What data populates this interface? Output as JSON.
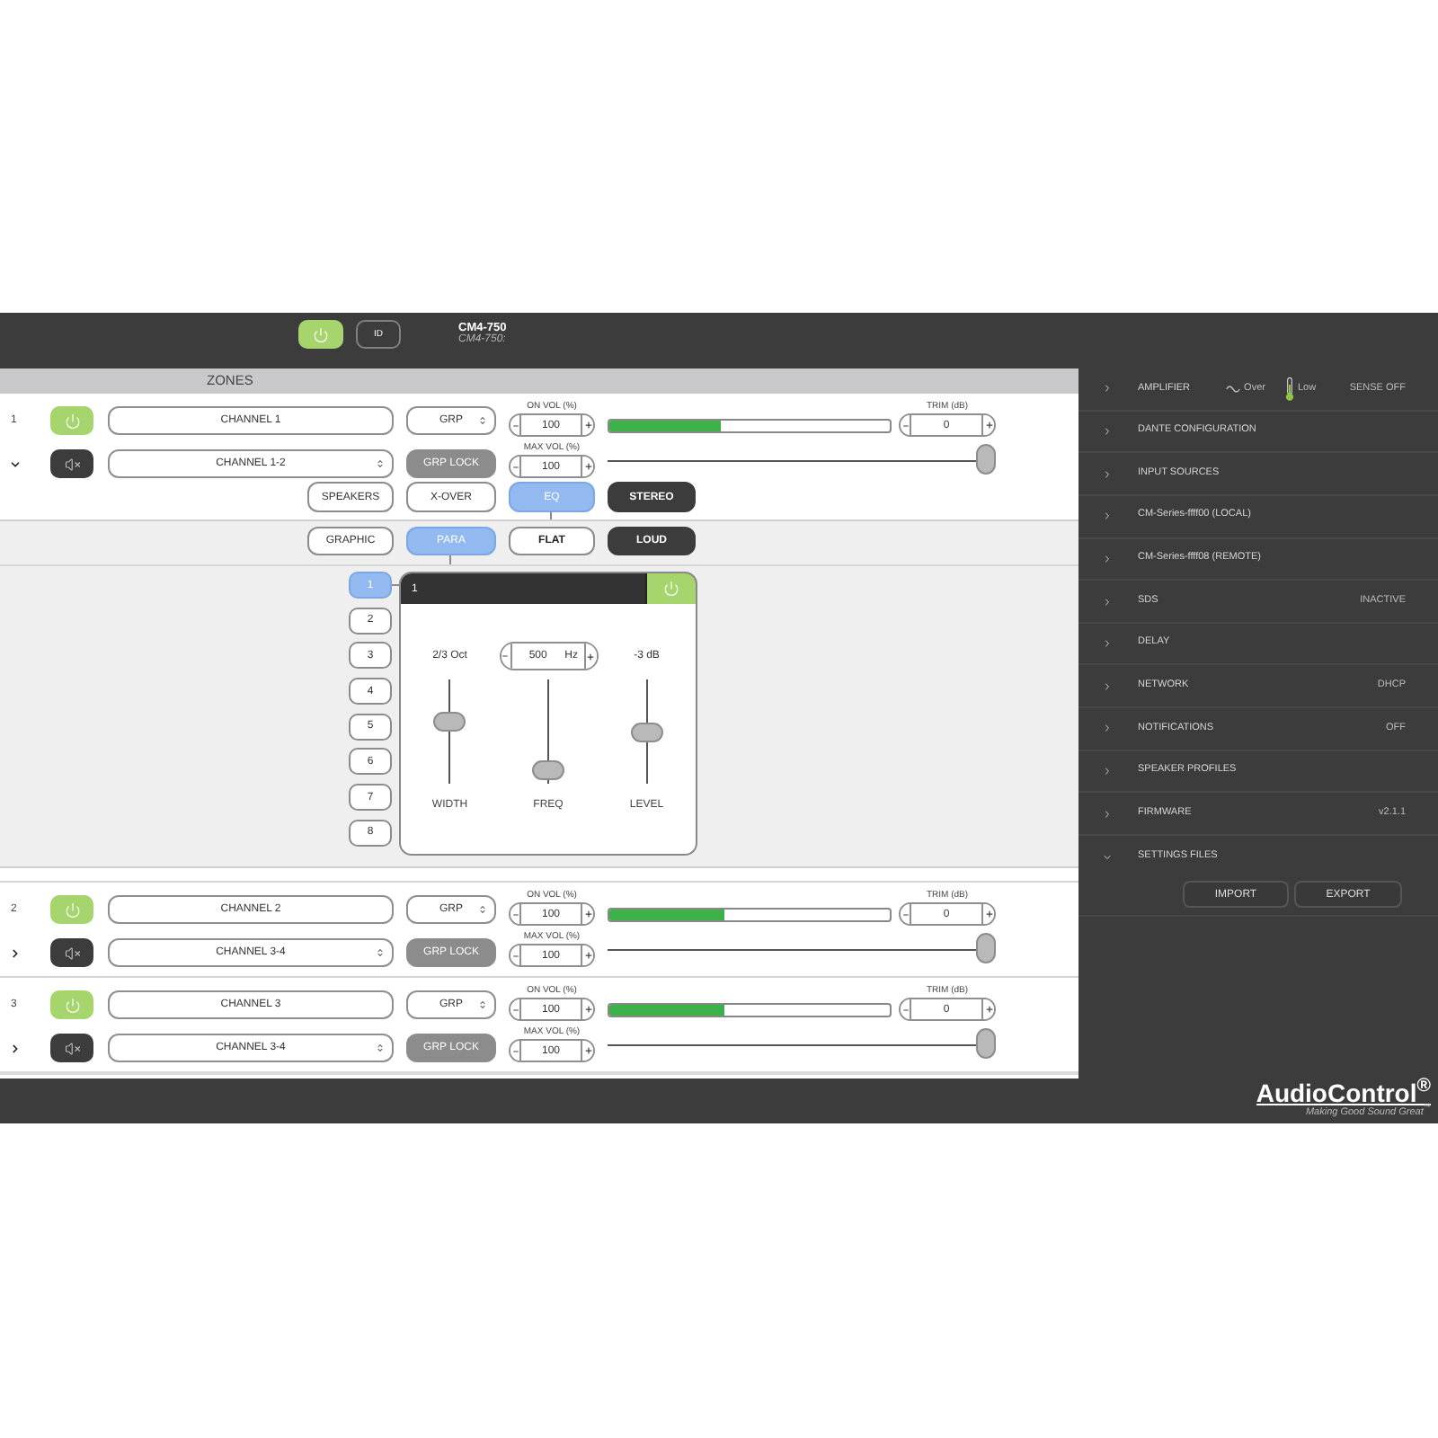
{
  "header": {
    "power_on": true,
    "id_label": "ID",
    "title": "CM4-750",
    "subtitle": "CM4-750:"
  },
  "zones": {
    "title": "ZONES",
    "items": [
      {
        "number": "1",
        "expanded": true,
        "power_on": true,
        "name": "CHANNEL 1",
        "group": "GRP",
        "source": "CHANNEL 1-2",
        "grp_lock": {
          "label": "GRP LOCK",
          "disabled": true
        },
        "on_vol": {
          "label": "ON VOL (%)",
          "value": "100"
        },
        "max_vol": {
          "label": "MAX VOL (%)",
          "value": "100"
        },
        "meter": {
          "level": 0.4
        },
        "trim": {
          "label": "TRIM (dB)",
          "value": "0"
        },
        "max_slider": {
          "level": 1
        },
        "modes": [
          {
            "kind": "tab",
            "label": "SPEAKERS",
            "selected": false
          },
          {
            "kind": "tab",
            "label": "X-OVER",
            "selected": false
          },
          {
            "kind": "tab",
            "label": "EQ",
            "selected": true
          },
          {
            "kind": "toggle",
            "label": "STEREO",
            "on": true
          }
        ],
        "eq": {
          "types": [
            {
              "kind": "tab",
              "label": "GRAPHIC",
              "selected": false
            },
            {
              "kind": "tab",
              "label": "PARA",
              "selected": true
            },
            {
              "kind": "toggle",
              "label": "FLAT",
              "on": false
            },
            {
              "kind": "toggle",
              "label": "LOUD",
              "on": true
            }
          ],
          "bands": [
            {
              "label": "1",
              "selected": true
            },
            {
              "label": "2",
              "selected": false
            },
            {
              "label": "3",
              "selected": false
            },
            {
              "label": "4",
              "selected": false
            },
            {
              "label": "5",
              "selected": false
            },
            {
              "label": "6",
              "selected": false
            },
            {
              "label": "7",
              "selected": false
            },
            {
              "label": "8",
              "selected": false
            }
          ],
          "band_panel": {
            "title": "1",
            "power_on": true,
            "controls": [
              {
                "kind": "readout",
                "reading": "2/3 Oct",
                "label": "WIDTH",
                "level": 0.59
              },
              {
                "kind": "stepper",
                "value": "500",
                "unit": "Hz",
                "label": "FREQ",
                "level": 0.13
              },
              {
                "kind": "readout",
                "reading": "-3 dB",
                "label": "LEVEL",
                "level": 0.5
              }
            ]
          }
        }
      },
      {
        "number": "2",
        "expanded": false,
        "power_on": true,
        "name": "CHANNEL 2",
        "group": "GRP",
        "source": "CHANNEL 3-4",
        "grp_lock": {
          "label": "GRP LOCK",
          "disabled": true
        },
        "on_vol": {
          "label": "ON VOL (%)",
          "value": "100"
        },
        "max_vol": {
          "label": "MAX VOL (%)",
          "value": "100"
        },
        "meter": {
          "level": 0.41
        },
        "trim": {
          "label": "TRIM (dB)",
          "value": "0"
        },
        "max_slider": {
          "level": 1
        }
      },
      {
        "number": "3",
        "expanded": false,
        "power_on": true,
        "name": "CHANNEL 3",
        "group": "GRP",
        "source": "CHANNEL 3-4",
        "grp_lock": {
          "label": "GRP LOCK",
          "disabled": true
        },
        "on_vol": {
          "label": "ON VOL (%)",
          "value": "100"
        },
        "max_vol": {
          "label": "MAX VOL (%)",
          "value": "100"
        },
        "meter": {
          "level": 0.41
        },
        "trim": {
          "label": "TRIM (dB)",
          "value": "0"
        },
        "max_slider": {
          "level": 1
        }
      }
    ]
  },
  "sidebar": {
    "items": [
      {
        "label": "AMPLIFIER",
        "expanded": false,
        "indicators": [
          {
            "kind": "wave",
            "label": "Over"
          },
          {
            "kind": "thermometer",
            "label": "Low"
          }
        ],
        "value": "SENSE OFF"
      },
      {
        "label": "DANTE CONFIGURATION",
        "expanded": false
      },
      {
        "label": "INPUT SOURCES",
        "expanded": false
      },
      {
        "label": "CM-Series-ffff00 (LOCAL)",
        "expanded": false
      },
      {
        "label": "CM-Series-ffff08 (REMOTE)",
        "expanded": false
      },
      {
        "label": "SDS",
        "expanded": false,
        "value": "INACTIVE"
      },
      {
        "label": "DELAY",
        "expanded": false
      },
      {
        "label": "NETWORK",
        "expanded": false,
        "value": "DHCP"
      },
      {
        "label": "NOTIFICATIONS",
        "expanded": false,
        "value": "OFF"
      },
      {
        "label": "SPEAKER PROFILES",
        "expanded": false
      },
      {
        "label": "FIRMWARE",
        "expanded": false,
        "value": "v2.1.1"
      },
      {
        "label": "SETTINGS FILES",
        "expanded": true,
        "buttons": [
          "IMPORT",
          "EXPORT"
        ]
      }
    ]
  },
  "logo": {
    "name": "AudioControl$^{®}$",
    "tagline": "Making Good Sound Great$^{™}$"
  }
}
